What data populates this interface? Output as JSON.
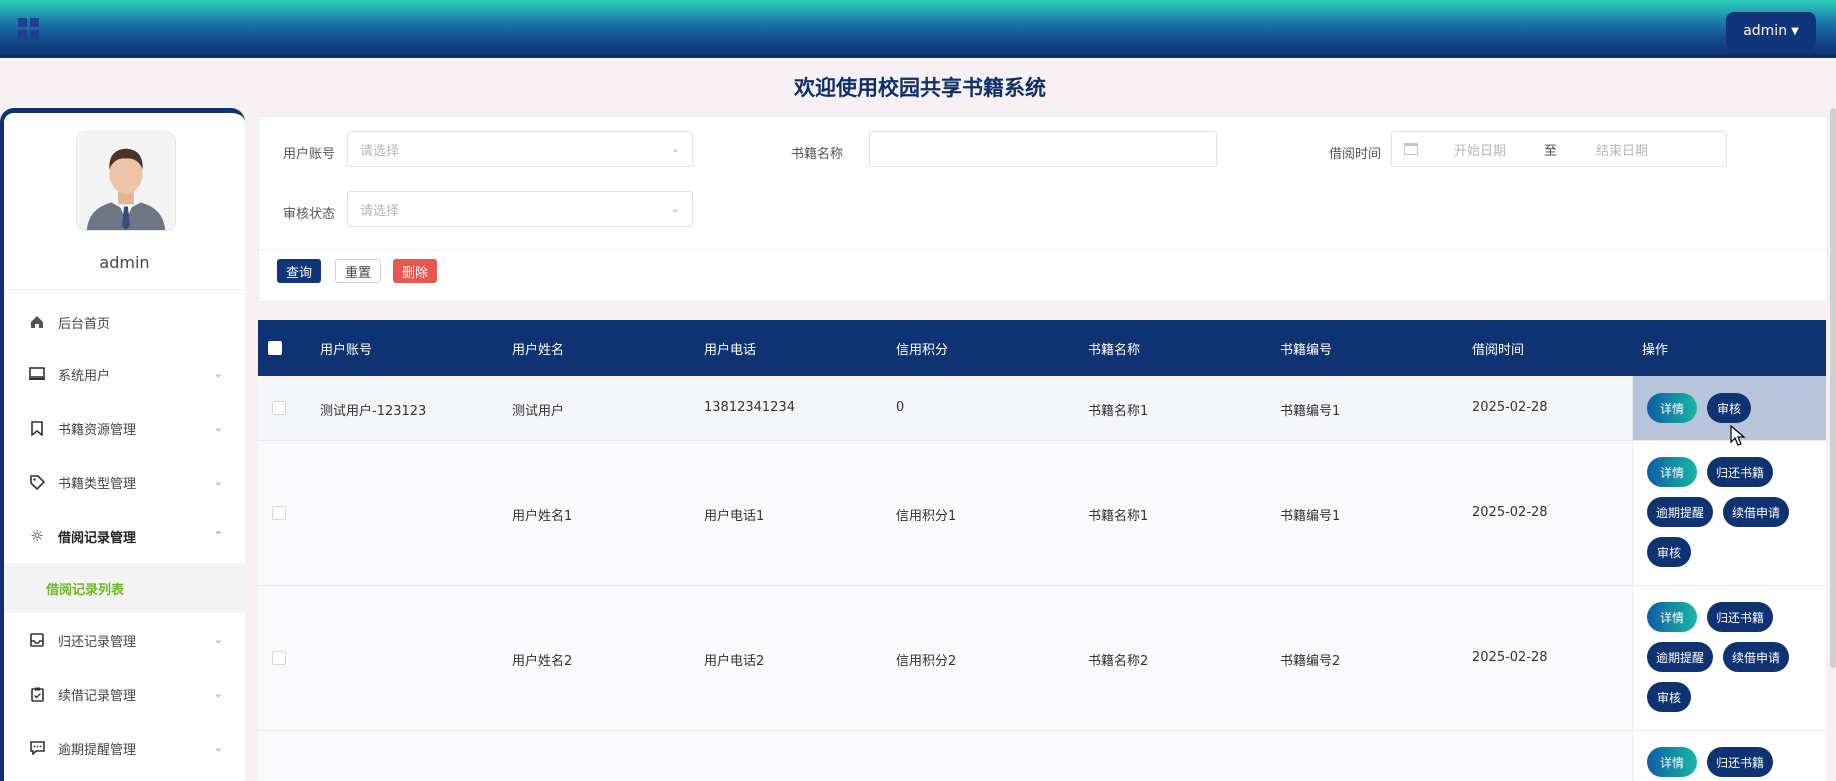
{
  "header": {
    "title": "欢迎使用校园共享书籍系统",
    "user_label": "admin"
  },
  "sidebar": {
    "username": "admin",
    "items": [
      {
        "label": "后台首页",
        "icon": "home-icon"
      },
      {
        "label": "系统用户",
        "icon": "monitor-icon"
      },
      {
        "label": "书籍资源管理",
        "icon": "bookmark-icon"
      },
      {
        "label": "书籍类型管理",
        "icon": "tag-icon"
      },
      {
        "label": "借阅记录管理",
        "icon": "sun-icon"
      },
      {
        "label": "归还记录管理",
        "icon": "inbox-icon"
      },
      {
        "label": "续借记录管理",
        "icon": "clipboard-icon"
      },
      {
        "label": "逾期提醒管理",
        "icon": "message-icon"
      }
    ],
    "sub_item": "借阅记录列表"
  },
  "search": {
    "account_label": "用户账号",
    "account_placeholder": "请选择",
    "book_label": "书籍名称",
    "time_label": "借阅时间",
    "start_placeholder": "开始日期",
    "range_sep": "至",
    "end_placeholder": "结束日期",
    "status_label": "审核状态",
    "status_placeholder": "请选择",
    "query": "查询",
    "reset": "重置",
    "delete": "删除"
  },
  "table": {
    "headers": [
      "用户账号",
      "用户姓名",
      "用户电话",
      "信用积分",
      "书籍名称",
      "书籍编号",
      "借阅时间",
      "操作"
    ],
    "rows": [
      {
        "account": "测试用户-123123",
        "name": "测试用户",
        "phone": "13812341234",
        "credit": "0",
        "book": "书籍名称1",
        "book_no": "书籍编号1",
        "time": "2025-02-28"
      },
      {
        "account": "",
        "name": "用户姓名1",
        "phone": "用户电话1",
        "credit": "信用积分1",
        "book": "书籍名称1",
        "book_no": "书籍编号1",
        "time": "2025-02-28"
      },
      {
        "account": "",
        "name": "用户姓名2",
        "phone": "用户电话2",
        "credit": "信用积分2",
        "book": "书籍名称2",
        "book_no": "书籍编号2",
        "time": "2025-02-28"
      }
    ],
    "ops": {
      "detail": "详情",
      "return": "归还书籍",
      "overdue": "逾期提醒",
      "renew": "续借申请",
      "audit": "审核"
    }
  }
}
